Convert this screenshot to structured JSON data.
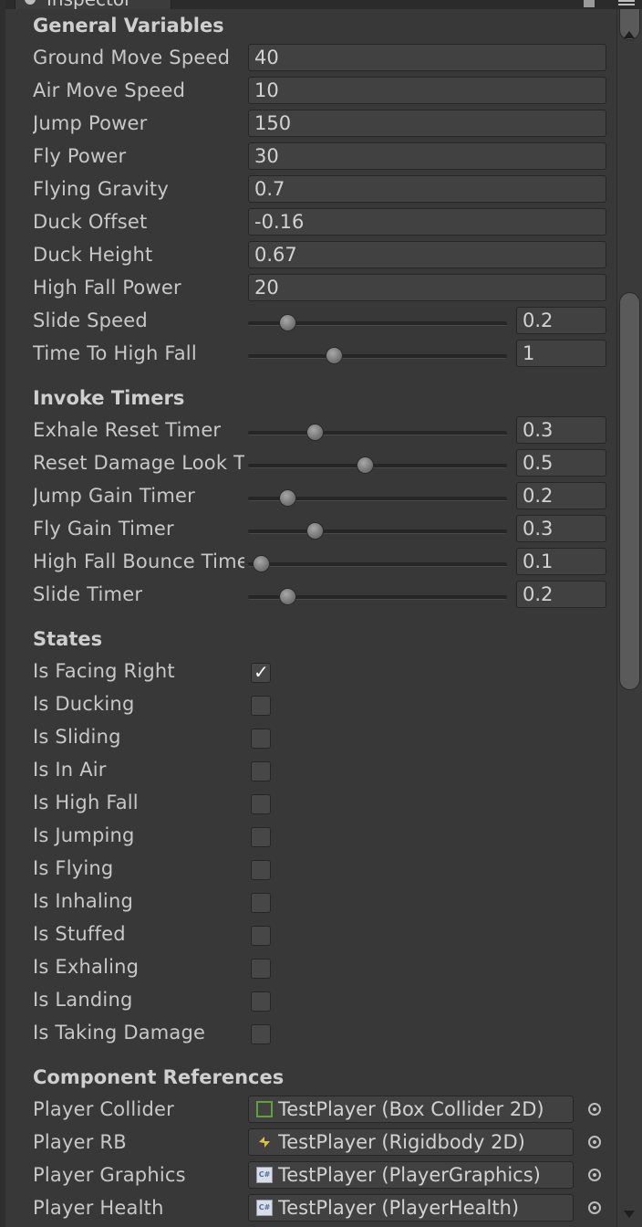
{
  "window": {
    "tab_title": "Inspector"
  },
  "general": {
    "header": "General Variables",
    "fields": [
      {
        "label": "Ground Move Speed",
        "value": "40"
      },
      {
        "label": "Air Move Speed",
        "value": "10"
      },
      {
        "label": "Jump Power",
        "value": "150"
      },
      {
        "label": "Fly Power",
        "value": "30"
      },
      {
        "label": "Flying Gravity",
        "value": "0.7"
      },
      {
        "label": "Duck Offset",
        "value": "-0.16"
      },
      {
        "label": "Duck Height",
        "value": "0.67"
      },
      {
        "label": "High Fall Power",
        "value": "20"
      }
    ],
    "sliders": [
      {
        "label": "Slide Speed",
        "value": "0.2",
        "level": 0.13
      },
      {
        "label": "Time To High Fall",
        "value": "1",
        "level": 0.32
      }
    ]
  },
  "timers": {
    "header": "Invoke Timers",
    "sliders": [
      {
        "label": "Exhale Reset Timer",
        "value": "0.3",
        "level": 0.24
      },
      {
        "label": "Reset Damage Look T",
        "value": "0.5",
        "level": 0.45
      },
      {
        "label": "Jump Gain Timer",
        "value": "0.2",
        "level": 0.13
      },
      {
        "label": "Fly Gain Timer",
        "value": "0.3",
        "level": 0.24
      },
      {
        "label": "High Fall Bounce Time",
        "value": "0.1",
        "level": 0.02
      },
      {
        "label": "Slide Timer",
        "value": "0.2",
        "level": 0.13
      }
    ]
  },
  "states": {
    "header": "States",
    "items": [
      {
        "label": "Is Facing Right",
        "checked": true,
        "check_glyph": "✓"
      },
      {
        "label": "Is Ducking",
        "checked": false
      },
      {
        "label": "Is Sliding",
        "checked": false
      },
      {
        "label": "Is In Air",
        "checked": false
      },
      {
        "label": "Is High Fall",
        "checked": false
      },
      {
        "label": "Is Jumping",
        "checked": false
      },
      {
        "label": "Is Flying",
        "checked": false
      },
      {
        "label": "Is Inhaling",
        "checked": false
      },
      {
        "label": "Is Stuffed",
        "checked": false
      },
      {
        "label": "Is Exhaling",
        "checked": false
      },
      {
        "label": "Is Landing",
        "checked": false
      },
      {
        "label": "Is Taking Damage",
        "checked": false
      }
    ]
  },
  "components": {
    "header": "Component References",
    "items": [
      {
        "label": "Player Collider",
        "value": "TestPlayer (Box Collider 2D)",
        "icon": "box-collider-icon"
      },
      {
        "label": "Player RB",
        "value": "TestPlayer (Rigidbody 2D)",
        "icon": "rigidbody-icon"
      },
      {
        "label": "Player Graphics",
        "value": "TestPlayer (PlayerGraphics)",
        "icon": "script-icon",
        "icon_text": "C#"
      },
      {
        "label": "Player Health",
        "value": "TestPlayer (PlayerHealth)",
        "icon": "script-icon",
        "icon_text": "C#"
      }
    ]
  },
  "colors": {
    "background": "#383838",
    "field_bg": "#414141",
    "text": "#c8c8c8",
    "collider_green": "#5ca33a",
    "rigidbody_yellow": "#e0c23a"
  }
}
